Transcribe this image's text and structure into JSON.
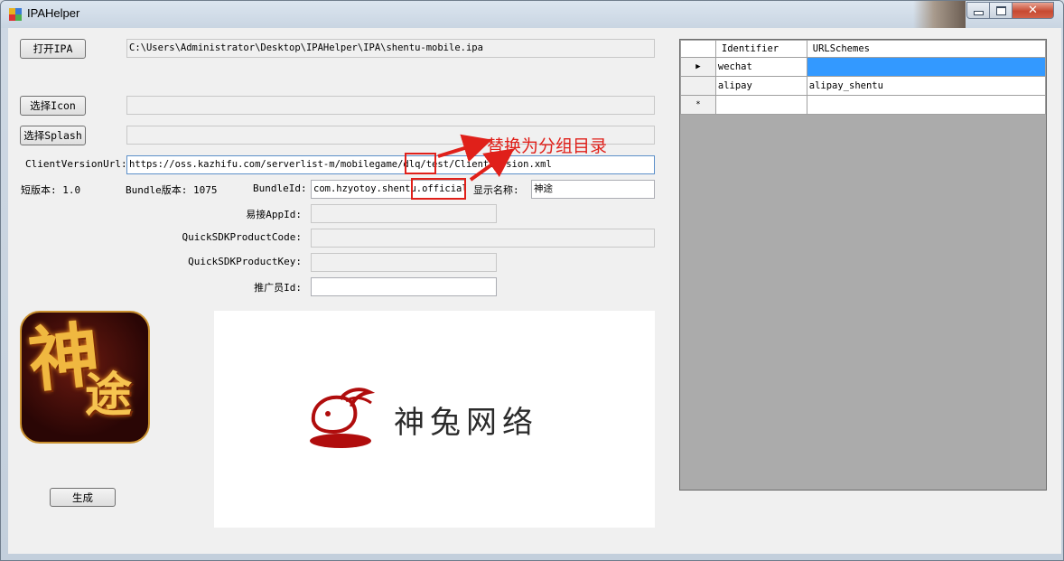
{
  "window": {
    "title": "IPAHelper",
    "close_glyph": "✕"
  },
  "buttons": {
    "open_ipa": "打开IPA",
    "select_icon": "选择Icon",
    "select_splash": "选择Splash",
    "generate": "生成"
  },
  "fields": {
    "ipa_path": "C:\\Users\\Administrator\\Desktop\\IPAHelper\\IPA\\shentu-mobile.ipa",
    "icon_path": "",
    "splash_path": "",
    "client_version_url_label": "ClientVersionUrl:",
    "client_version_url": "https://oss.kazhifu.com/serverlist-m/mobilegame/dlq/test/ClientVersion.xml",
    "short_version_label": "短版本: 1.0",
    "bundle_version_label": "Bundle版本: 1075",
    "bundle_id_label": "BundleId:",
    "bundle_id": "com.hzyotoy.shentu.official",
    "display_name_label": "显示名称:",
    "display_name": "神途",
    "yijie_app_id_label": "易接AppId:",
    "yijie_app_id": "",
    "quicksdk_product_code_label": "QuickSDKProductCode:",
    "quicksdk_product_code": "",
    "quicksdk_product_key_label": "QuickSDKProductKey:",
    "quicksdk_product_key": "",
    "promoter_id_label": "推广员Id:",
    "promoter_id": ""
  },
  "annotation": {
    "text": "替换为分组目录"
  },
  "icon_preview": {
    "text": "神途"
  },
  "splash_preview": {
    "logo_text": "神兔网络"
  },
  "grid": {
    "columns": [
      "Identifier",
      "URLSchemes"
    ],
    "rows": [
      {
        "marker": "▶",
        "identifier": "wechat",
        "schemes": ""
      },
      {
        "marker": "",
        "identifier": "alipay",
        "schemes": "alipay_shentu"
      },
      {
        "marker": "*",
        "identifier": "",
        "schemes": ""
      }
    ]
  }
}
